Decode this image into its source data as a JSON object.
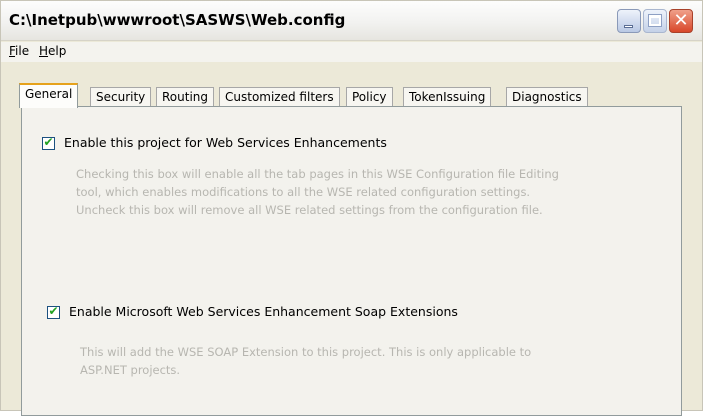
{
  "window": {
    "title": "C:\\Inetpub\\wwwroot\\SASWS\\Web.config",
    "controls": [
      "minimize",
      "maximize",
      "close"
    ]
  },
  "menu": {
    "file": "File",
    "help": "Help"
  },
  "tabs": [
    {
      "label": "General",
      "active": true
    },
    {
      "label": "Security",
      "active": false
    },
    {
      "label": "Routing",
      "active": false
    },
    {
      "label": "Customized filters",
      "active": false
    },
    {
      "label": "Policy",
      "active": false
    },
    {
      "label": "TokenIssuing",
      "active": false
    },
    {
      "label": "Diagnostics",
      "active": false
    }
  ],
  "general": {
    "enable_project": {
      "label": "Enable this project for Web Services Enhancements",
      "checked": true,
      "description": [
        "Checking this box will enable all the tab pages in this WSE Configuration file Editing",
        "tool, which enables modifications to all the WSE related configuration settings.",
        "Uncheck this box will remove all WSE related settings from the configuration file."
      ]
    },
    "enable_soap": {
      "label": "Enable Microsoft Web Services Enhancement Soap Extensions",
      "checked": true,
      "description": [
        "This will add the WSE SOAP Extension to this project. This is only applicable to",
        "ASP.NET projects."
      ]
    }
  },
  "colors": {
    "check_mark": "#21a121",
    "active_tab_highlight": "#e6a21b",
    "close_button": "#d8472a"
  }
}
